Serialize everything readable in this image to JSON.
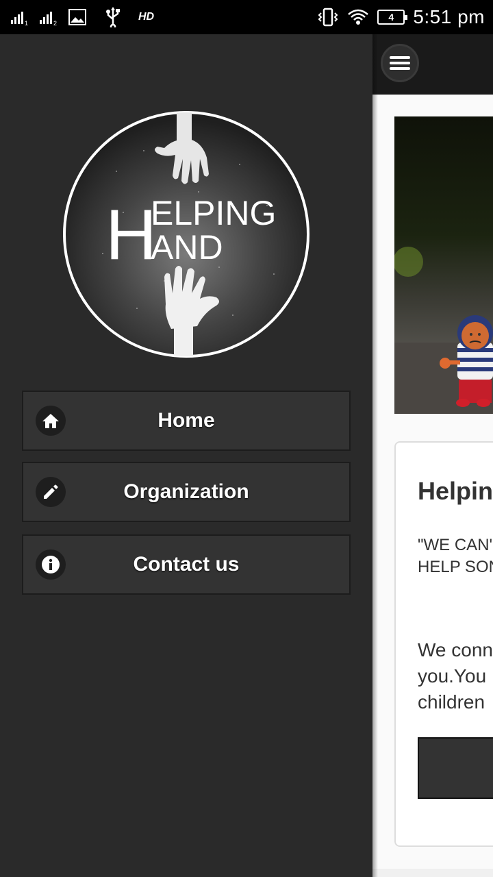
{
  "status_bar": {
    "sim1_index": "1",
    "sim2_index": "2",
    "network": "HD",
    "battery_level": "4",
    "time": "5:51 pm"
  },
  "drawer": {
    "logo": {
      "line1": "ELPING",
      "line2": "AND",
      "initial": "H"
    },
    "menu": [
      {
        "label": "Home",
        "icon": "home-icon"
      },
      {
        "label": "Organization",
        "icon": "pencil-icon"
      },
      {
        "label": "Contact us",
        "icon": "info-icon"
      }
    ]
  },
  "main": {
    "menu_button_icon": "hamburger-icon",
    "hero_image": "toy-figure-photo",
    "card": {
      "title": "Helpin",
      "quote": "\"WE CAN'\nHELP SON",
      "body": "We conn\nyou.You\nchildren"
    }
  },
  "colors": {
    "drawer_bg": "#2a2a2a",
    "menu_item_bg": "#333333",
    "status_bar_bg": "#000000",
    "content_bg": "#fafafa"
  }
}
